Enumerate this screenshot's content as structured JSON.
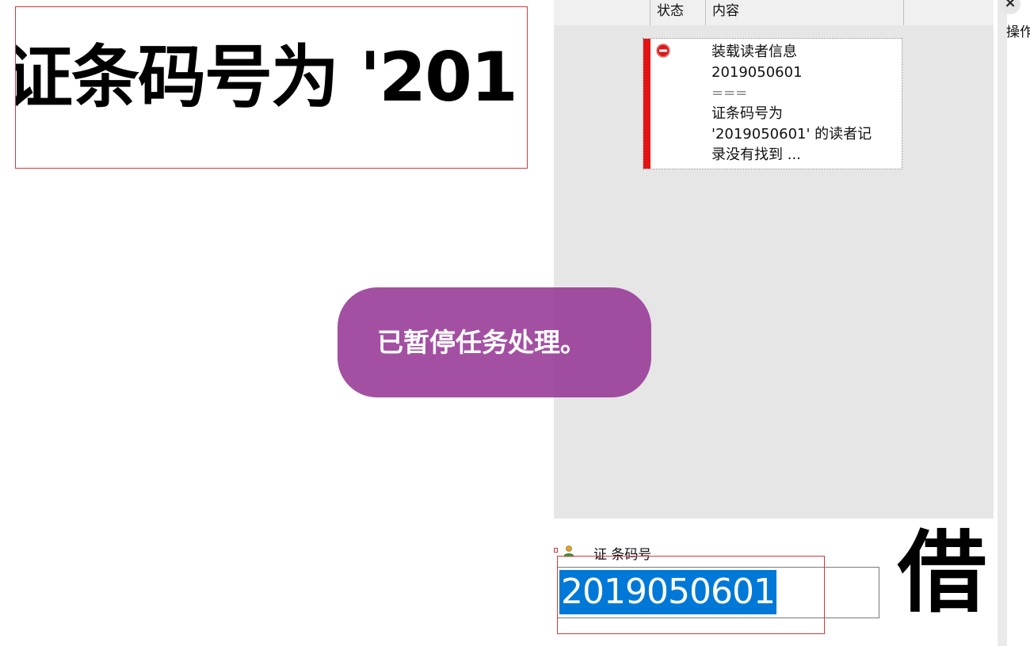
{
  "overlay": {
    "big_text": "证条码号为 '201"
  },
  "list": {
    "columns": [
      "",
      "状态",
      "内容"
    ],
    "message": {
      "icon": "error-icon",
      "lines": [
        "装载读者信息",
        "2019050601",
        "===",
        "证条码号为",
        "'2019050601' 的读者记",
        "录没有找到 ..."
      ]
    }
  },
  "toast": {
    "text": "已暂停任务处理。"
  },
  "side": {
    "close_label": "×",
    "op_label": "操作"
  },
  "input_area": {
    "label": "证 条码号",
    "value": "2019050601",
    "big_label": "借"
  },
  "colors": {
    "panel_bg": "#e6e6e6",
    "error_bar": "#e21414",
    "toast_bg": "#963896",
    "selection": "#0078d7"
  }
}
